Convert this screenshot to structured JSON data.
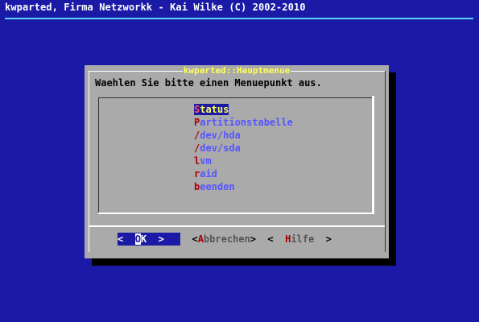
{
  "backtitle": "kwparted, Firma Netzworkk - Kai Wilke (C) 2002-2010",
  "dialog": {
    "title": "kwparted::Hauptmenue",
    "prompt": "Waehlen Sie bitte einen Menuepunkt aus."
  },
  "menu": {
    "items": [
      {
        "hotkey": "S",
        "rest": "tatus",
        "selected": true
      },
      {
        "hotkey": "P",
        "rest": "artitionstabelle",
        "selected": false
      },
      {
        "hotkey": "/",
        "rest": "dev/hda",
        "selected": false
      },
      {
        "hotkey": "/",
        "rest": "dev/sda",
        "selected": false
      },
      {
        "hotkey": "l",
        "rest": "vm",
        "selected": false
      },
      {
        "hotkey": "r",
        "rest": "aid",
        "selected": false
      },
      {
        "hotkey": "b",
        "rest": "eenden",
        "selected": false
      }
    ]
  },
  "buttons": {
    "ok": {
      "left": "<  ",
      "hotkey": "O",
      "rest": "K",
      "right": "  >"
    },
    "cancel": {
      "left": "<",
      "hotkey": "A",
      "rest": "bbrechen",
      "right": ">"
    },
    "help": {
      "left": "<  ",
      "hotkey": "H",
      "rest": "ilfe",
      "right": "  >"
    }
  },
  "colors": {
    "background": "#1a1aa6",
    "dialog": "#aaaaaa",
    "title": "#ffff55",
    "hotkey": "#aa0000",
    "item": "#5555ff"
  }
}
